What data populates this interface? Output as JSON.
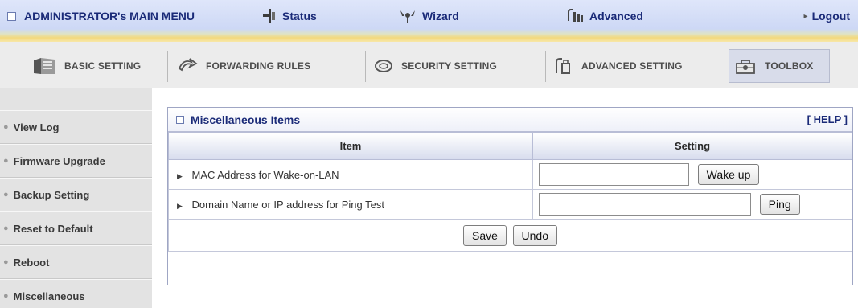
{
  "topbar": {
    "title": "ADMINISTRATOR's MAIN MENU",
    "status": "Status",
    "wizard": "Wizard",
    "advanced": "Advanced",
    "logout": "Logout"
  },
  "tabs": {
    "basic": "BASIC SETTING",
    "forwarding": "FORWARDING RULES",
    "security": "SECURITY SETTING",
    "advanced": "ADVANCED SETTING",
    "toolbox": "TOOLBOX"
  },
  "sidebar": {
    "items": [
      {
        "label": "View Log"
      },
      {
        "label": "Firmware Upgrade"
      },
      {
        "label": "Backup Setting"
      },
      {
        "label": "Reset to Default"
      },
      {
        "label": "Reboot"
      },
      {
        "label": "Miscellaneous"
      }
    ]
  },
  "panel": {
    "title": "Miscellaneous Items",
    "help": "[ HELP ]",
    "columns": {
      "item": "Item",
      "setting": "Setting"
    },
    "rows": [
      {
        "label": "MAC Address for Wake-on-LAN",
        "value": "",
        "button": "Wake up"
      },
      {
        "label": "Domain Name or IP address for Ping Test",
        "value": "",
        "button": "Ping"
      }
    ],
    "save": "Save",
    "undo": "Undo"
  },
  "colors": {
    "accent_text": "#1a2a78",
    "topbar_bg": "#cdd8f5",
    "topbar_stripe": "#f3d97c",
    "sidebar_bg": "#e3e3e3"
  }
}
